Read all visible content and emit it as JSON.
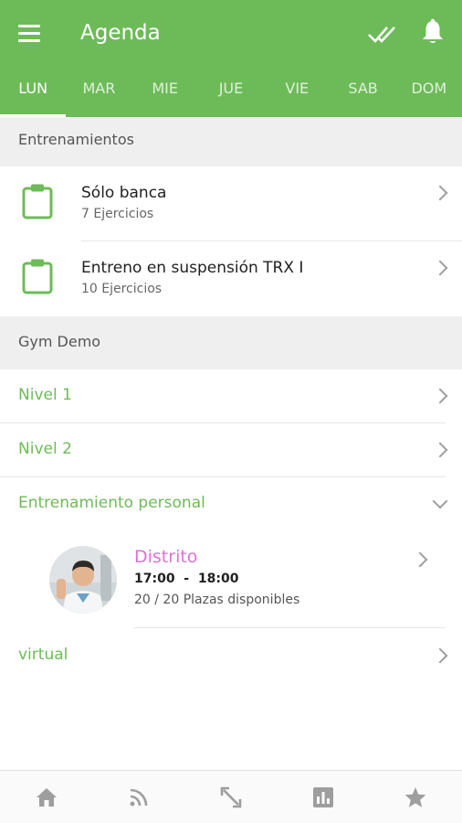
{
  "appbar": {
    "title": "Agenda",
    "icons": [
      "menu-icon",
      "double-check-icon",
      "bell-icon"
    ]
  },
  "tabs": [
    {
      "label": "LUN",
      "active": true
    },
    {
      "label": "MAR",
      "active": false
    },
    {
      "label": "MIE",
      "active": false
    },
    {
      "label": "JUE",
      "active": false
    },
    {
      "label": "VIE",
      "active": false
    },
    {
      "label": "SAB",
      "active": false
    },
    {
      "label": "DOM",
      "active": false
    }
  ],
  "sections": {
    "trainings_header": "Entrenamientos",
    "gym_header": "Gym Demo"
  },
  "workouts": [
    {
      "title": "Sólo banca",
      "subtitle": "7 Ejercicios"
    },
    {
      "title": "Entreno en suspensión TRX I",
      "subtitle": "10 Ejercicios"
    }
  ],
  "categories": [
    {
      "label": "Nivel 1"
    },
    {
      "label": "Nivel 2"
    },
    {
      "label": "Entrenamiento personal"
    },
    {
      "label": "virtual"
    }
  ],
  "class_item": {
    "title": "Distrito",
    "time": "17:00  -  18:00",
    "places": "20 / 20 Plazas disponibles"
  },
  "bottom_nav": [
    "home-icon",
    "rss-feed-icon",
    "expand-arrows-icon",
    "chart-icon",
    "star-icon"
  ],
  "colors": {
    "primary": "#6dbb58",
    "accent_pink": "#e070d3",
    "section_bg": "#efefef"
  }
}
